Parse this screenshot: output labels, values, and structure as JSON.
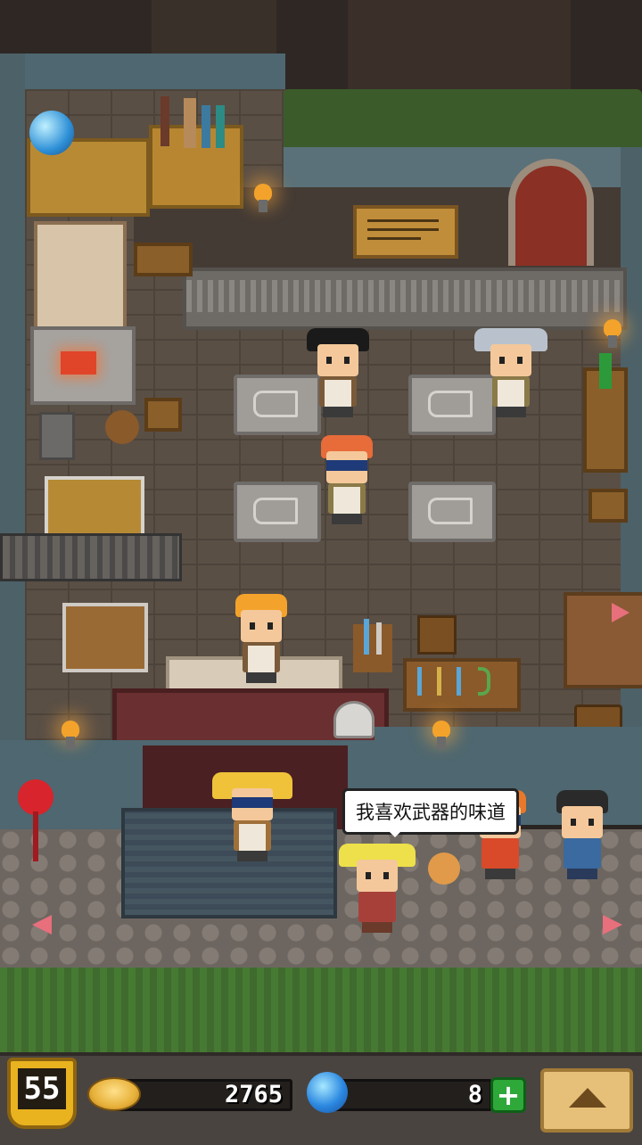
{
  "scene": {
    "speech_bubble": "我喜欢武器的味道"
  },
  "hud": {
    "level": "55",
    "gold": "2765",
    "gems": "8",
    "add_gems_label": "+"
  },
  "colors": {
    "gold_badge": "#e9b21f",
    "plus_green": "#2fa83a",
    "gem_blue": "#2b88e0",
    "arrow_pink": "#e86f7c"
  }
}
